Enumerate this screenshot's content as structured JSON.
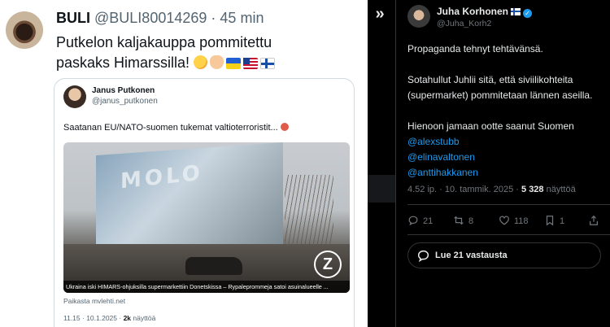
{
  "left_tweet": {
    "author_name": "BULI",
    "author_handle": "@BULI80014269",
    "separator": "·",
    "time_ago": "45 min",
    "text_line1": "Putkelon kaljakauppa pommitettu",
    "text_line2": "paskaks Himarssilla!",
    "emoji_icons": [
      "party-face",
      "flexed-biceps",
      "ukraine-flag",
      "us-flag",
      "finland-flag"
    ],
    "quote": {
      "author_name": "Janus Putkonen",
      "author_handle": "@janus_putkonen",
      "text": "Saatanan EU/NATO-suomen tukemat valtioterroristit...",
      "image_caption": "Ukraina iski HIMARS-ohjuksilla supermarkettiin Donetskissa – Rypaleprommeja satoi asuinalueelle ...",
      "image_sign_text": "MOLO",
      "source": "Paikasta mvlehti.net",
      "timestamp": "11.15 · 10.1.2025 ·",
      "views_count": "2k",
      "views_label": "näyttöä"
    }
  },
  "right_tweet": {
    "author_name": "Juha Korhonen",
    "author_handle": "@Juha_Korh2",
    "paragraph1": "Propaganda tehnyt tehtävänsä.",
    "paragraph2": "Sotahullut Juhlii sitä, että siviilikohteita (supermarket) pommitetaan lännen aseilla.",
    "paragraph3_text": "Hienoon jamaan ootte saanut Suomen",
    "mentions": [
      "@alexstubb",
      "@elinavaltonen",
      "@anttihakkanen"
    ],
    "timestamp": "4.52 ip. · 10. tammik. 2025 ·",
    "views_count": "5 328",
    "views_label": "näyttöä",
    "actions": {
      "replies": "21",
      "reposts": "8",
      "likes": "118",
      "bookmarks": "1"
    },
    "reply_button_label": "Lue 21 vastausta"
  },
  "colors": {
    "accent_blue": "#1d9bf0",
    "dark_bg": "#000000",
    "light_bg": "#ffffff",
    "muted_text": "#71767b"
  }
}
